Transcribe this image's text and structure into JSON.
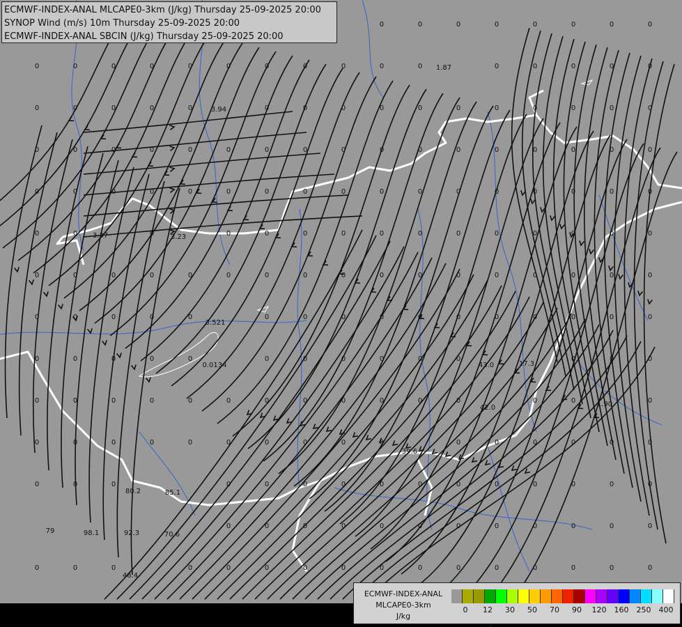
{
  "header": {
    "line1": "ECMWF-INDEX-ANAL MLCAPE0-3km (J/kg) Thursday 25-09-2025 20:00",
    "line2": "SYNOP Wind (m/s) 10m Thursday 25-09-2025 20:00",
    "line3": "ECMWF-INDEX-ANAL SBCIN (J/kg) Thursday 25-09-2025 20:00"
  },
  "legend": {
    "line1": "ECMWF-INDEX-ANAL",
    "line2": "MLCAPE0-3km",
    "line3": "J/kg",
    "colors": [
      "#999999",
      "#aaaa00",
      "#999900",
      "#00aa00",
      "#00ff00",
      "#aaff00",
      "#ffff00",
      "#ffcc00",
      "#ff9900",
      "#ff6600",
      "#ee2200",
      "#aa0000",
      "#ff00ff",
      "#aa00ff",
      "#6600ff",
      "#0000ff",
      "#0088ff",
      "#00ddff",
      "#88ffff",
      "#ffffff"
    ],
    "tick_labels": [
      "0",
      "12",
      "30",
      "50",
      "70",
      "90",
      "120",
      "160",
      "250",
      "400"
    ]
  },
  "map_colors": {
    "background": "#999999",
    "borders": "#ffffff",
    "rivers": "#3366cc",
    "streamlines": "#111111"
  },
  "station_values": [
    {
      "v": "0"
    },
    {
      "v": "0"
    },
    {
      "v": "0"
    },
    {
      "v": "0"
    },
    {
      "v": "0"
    },
    {
      "v": "0"
    },
    {
      "v": "0"
    },
    {
      "v": "0"
    },
    {
      "v": "1.87"
    },
    {
      "v": "3.94"
    },
    {
      "v": "3.23"
    },
    {
      "v": "3.37"
    },
    {
      "v": "3.521"
    },
    {
      "v": "0.0134"
    },
    {
      "v": "43.0"
    },
    {
      "v": "17.3"
    },
    {
      "v": "42.0"
    },
    {
      "v": "1.90"
    },
    {
      "v": "39.6"
    },
    {
      "v": "80.2"
    },
    {
      "v": "85.1"
    },
    {
      "v": "79"
    },
    {
      "v": "98.1"
    },
    {
      "v": "92.3"
    },
    {
      "v": "70.6"
    },
    {
      "v": "48.4"
    }
  ]
}
